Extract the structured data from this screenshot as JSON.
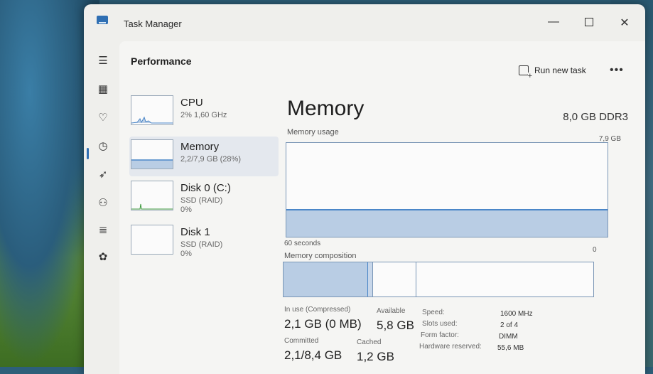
{
  "window": {
    "title": "Task Manager"
  },
  "header": {
    "section": "Performance",
    "run_new_task": "Run new task",
    "more": "•••"
  },
  "rail": {
    "items": [
      {
        "icon": "hamburger-icon"
      },
      {
        "icon": "processes-icon"
      },
      {
        "icon": "performance-icon",
        "active": true
      },
      {
        "icon": "app-history-icon"
      },
      {
        "icon": "startup-icon"
      },
      {
        "icon": "users-icon"
      },
      {
        "icon": "details-icon"
      },
      {
        "icon": "services-icon"
      }
    ]
  },
  "devices": [
    {
      "title": "CPU",
      "sub": "2% 1,60 GHz",
      "sub2": ""
    },
    {
      "title": "Memory",
      "sub": "2,2/7,9 GB (28%)",
      "sub2": ""
    },
    {
      "title": "Disk 0 (C:)",
      "sub": "SSD (RAID)",
      "sub2": "0%"
    },
    {
      "title": "Disk 1",
      "sub": "SSD (RAID)",
      "sub2": "0%"
    }
  ],
  "detail": {
    "heading": "Memory",
    "type": "8,0 GB DDR3",
    "usage_label": "Memory usage",
    "usage_max": "7,9 GB",
    "usage_fraction": 0.28,
    "time_label": "60 seconds",
    "zero_label": "0",
    "composition_label": "Memory composition",
    "stats": {
      "in_use_label": "In use (Compressed)",
      "in_use_value": "2,1 GB (0 MB)",
      "available_label": "Available",
      "available_value": "5,8 GB",
      "committed_label": "Committed",
      "committed_value": "2,1/8,4 GB",
      "cached_label": "Cached",
      "cached_value": "1,2 GB"
    },
    "properties": [
      {
        "key": "Speed:",
        "value": "1600 MHz"
      },
      {
        "key": "Slots used:",
        "value": "2 of 4"
      },
      {
        "key": "Form factor:",
        "value": "DIMM"
      },
      {
        "key": "Hardware reserved:",
        "value": "55,6 MB"
      }
    ]
  },
  "colors": {
    "accent": "#2f6fb3",
    "graph_fill": "#b9cde4",
    "graph_line": "#4a86c8"
  }
}
